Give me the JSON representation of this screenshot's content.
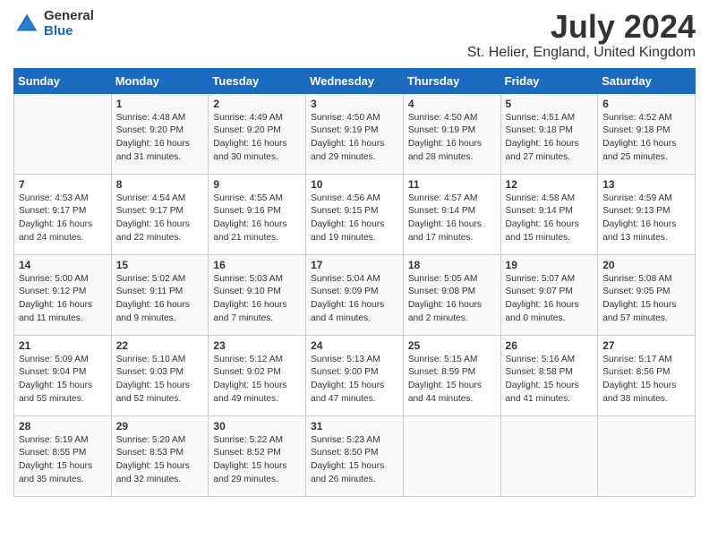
{
  "logo": {
    "general": "General",
    "blue": "Blue"
  },
  "title": "July 2024",
  "subtitle": "St. Helier, England, United Kingdom",
  "days_of_week": [
    "Sunday",
    "Monday",
    "Tuesday",
    "Wednesday",
    "Thursday",
    "Friday",
    "Saturday"
  ],
  "weeks": [
    [
      {
        "day": "",
        "info": ""
      },
      {
        "day": "1",
        "info": "Sunrise: 4:48 AM\nSunset: 9:20 PM\nDaylight: 16 hours\nand 31 minutes."
      },
      {
        "day": "2",
        "info": "Sunrise: 4:49 AM\nSunset: 9:20 PM\nDaylight: 16 hours\nand 30 minutes."
      },
      {
        "day": "3",
        "info": "Sunrise: 4:50 AM\nSunset: 9:19 PM\nDaylight: 16 hours\nand 29 minutes."
      },
      {
        "day": "4",
        "info": "Sunrise: 4:50 AM\nSunset: 9:19 PM\nDaylight: 16 hours\nand 28 minutes."
      },
      {
        "day": "5",
        "info": "Sunrise: 4:51 AM\nSunset: 9:18 PM\nDaylight: 16 hours\nand 27 minutes."
      },
      {
        "day": "6",
        "info": "Sunrise: 4:52 AM\nSunset: 9:18 PM\nDaylight: 16 hours\nand 25 minutes."
      }
    ],
    [
      {
        "day": "7",
        "info": "Sunrise: 4:53 AM\nSunset: 9:17 PM\nDaylight: 16 hours\nand 24 minutes."
      },
      {
        "day": "8",
        "info": "Sunrise: 4:54 AM\nSunset: 9:17 PM\nDaylight: 16 hours\nand 22 minutes."
      },
      {
        "day": "9",
        "info": "Sunrise: 4:55 AM\nSunset: 9:16 PM\nDaylight: 16 hours\nand 21 minutes."
      },
      {
        "day": "10",
        "info": "Sunrise: 4:56 AM\nSunset: 9:15 PM\nDaylight: 16 hours\nand 19 minutes."
      },
      {
        "day": "11",
        "info": "Sunrise: 4:57 AM\nSunset: 9:14 PM\nDaylight: 16 hours\nand 17 minutes."
      },
      {
        "day": "12",
        "info": "Sunrise: 4:58 AM\nSunset: 9:14 PM\nDaylight: 16 hours\nand 15 minutes."
      },
      {
        "day": "13",
        "info": "Sunrise: 4:59 AM\nSunset: 9:13 PM\nDaylight: 16 hours\nand 13 minutes."
      }
    ],
    [
      {
        "day": "14",
        "info": "Sunrise: 5:00 AM\nSunset: 9:12 PM\nDaylight: 16 hours\nand 11 minutes."
      },
      {
        "day": "15",
        "info": "Sunrise: 5:02 AM\nSunset: 9:11 PM\nDaylight: 16 hours\nand 9 minutes."
      },
      {
        "day": "16",
        "info": "Sunrise: 5:03 AM\nSunset: 9:10 PM\nDaylight: 16 hours\nand 7 minutes."
      },
      {
        "day": "17",
        "info": "Sunrise: 5:04 AM\nSunset: 9:09 PM\nDaylight: 16 hours\nand 4 minutes."
      },
      {
        "day": "18",
        "info": "Sunrise: 5:05 AM\nSunset: 9:08 PM\nDaylight: 16 hours\nand 2 minutes."
      },
      {
        "day": "19",
        "info": "Sunrise: 5:07 AM\nSunset: 9:07 PM\nDaylight: 16 hours\nand 0 minutes."
      },
      {
        "day": "20",
        "info": "Sunrise: 5:08 AM\nSunset: 9:05 PM\nDaylight: 15 hours\nand 57 minutes."
      }
    ],
    [
      {
        "day": "21",
        "info": "Sunrise: 5:09 AM\nSunset: 9:04 PM\nDaylight: 15 hours\nand 55 minutes."
      },
      {
        "day": "22",
        "info": "Sunrise: 5:10 AM\nSunset: 9:03 PM\nDaylight: 15 hours\nand 52 minutes."
      },
      {
        "day": "23",
        "info": "Sunrise: 5:12 AM\nSunset: 9:02 PM\nDaylight: 15 hours\nand 49 minutes."
      },
      {
        "day": "24",
        "info": "Sunrise: 5:13 AM\nSunset: 9:00 PM\nDaylight: 15 hours\nand 47 minutes."
      },
      {
        "day": "25",
        "info": "Sunrise: 5:15 AM\nSunset: 8:59 PM\nDaylight: 15 hours\nand 44 minutes."
      },
      {
        "day": "26",
        "info": "Sunrise: 5:16 AM\nSunset: 8:58 PM\nDaylight: 15 hours\nand 41 minutes."
      },
      {
        "day": "27",
        "info": "Sunrise: 5:17 AM\nSunset: 8:56 PM\nDaylight: 15 hours\nand 38 minutes."
      }
    ],
    [
      {
        "day": "28",
        "info": "Sunrise: 5:19 AM\nSunset: 8:55 PM\nDaylight: 15 hours\nand 35 minutes."
      },
      {
        "day": "29",
        "info": "Sunrise: 5:20 AM\nSunset: 8:53 PM\nDaylight: 15 hours\nand 32 minutes."
      },
      {
        "day": "30",
        "info": "Sunrise: 5:22 AM\nSunset: 8:52 PM\nDaylight: 15 hours\nand 29 minutes."
      },
      {
        "day": "31",
        "info": "Sunrise: 5:23 AM\nSunset: 8:50 PM\nDaylight: 15 hours\nand 26 minutes."
      },
      {
        "day": "",
        "info": ""
      },
      {
        "day": "",
        "info": ""
      },
      {
        "day": "",
        "info": ""
      }
    ]
  ]
}
